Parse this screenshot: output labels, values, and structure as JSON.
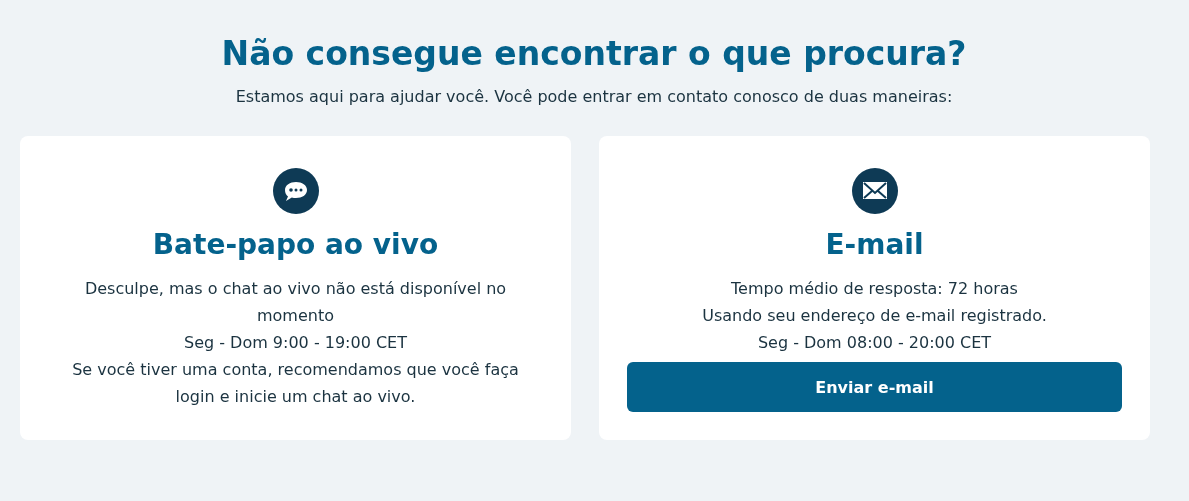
{
  "heading": "Não consegue encontrar o que procura?",
  "subheading": "Estamos aqui para ajudar você. Você pode entrar em contato conosco de duas maneiras:",
  "cards": [
    {
      "kind": "chat",
      "title": "Bate-papo ao vivo",
      "lines": [
        "Desculpe, mas o chat ao vivo não está disponível no momento",
        "Seg - Dom 9:00 - 19:00 CET",
        "Se você tiver uma conta, recomendamos que você faça login e inicie um chat ao vivo."
      ]
    },
    {
      "kind": "email",
      "title": "E-mail",
      "lines": [
        "Tempo médio de resposta: 72 horas",
        "Usando seu endereço de e-mail registrado.",
        "Seg - Dom 08:00 - 20:00 CET"
      ],
      "button": "Enviar e-mail"
    }
  ]
}
